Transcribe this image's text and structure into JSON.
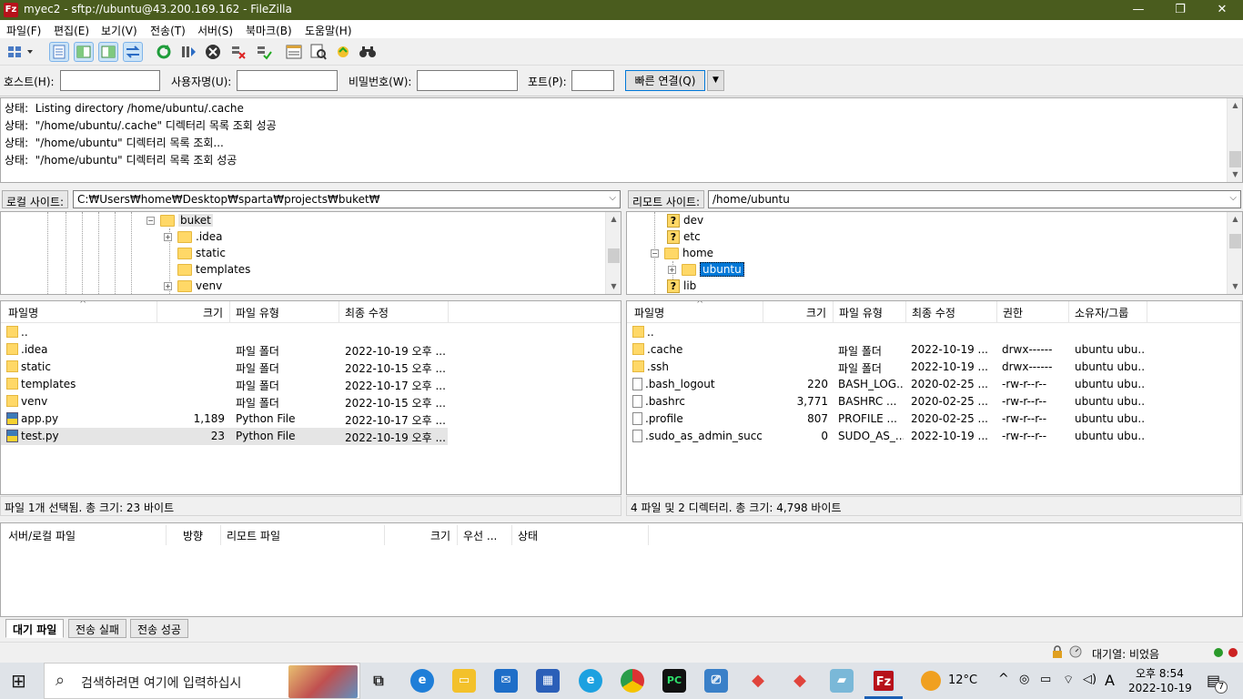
{
  "window": {
    "title": "myec2 - sftp://ubuntu@43.200.169.162 - FileZilla",
    "app_icon": "Fz",
    "controls": {
      "minimize": "—",
      "restore": "❐",
      "close": "✕"
    }
  },
  "menu": [
    "파일(F)",
    "편집(E)",
    "보기(V)",
    "전송(T)",
    "서버(S)",
    "북마크(B)",
    "도움말(H)"
  ],
  "quickconnect": {
    "host_label": "호스트(H):",
    "user_label": "사용자명(U):",
    "pass_label": "비밀번호(W):",
    "port_label": "포트(P):",
    "host_value": "",
    "user_value": "",
    "pass_value": "",
    "port_value": "",
    "connect_label": "빠른 연결(Q)",
    "dropdown": "▼"
  },
  "log": [
    {
      "tag": "상태:",
      "msg": "Listing directory /home/ubuntu/.cache"
    },
    {
      "tag": "상태:",
      "msg": "\"/home/ubuntu/.cache\" 디렉터리 목록 조회 성공"
    },
    {
      "tag": "상태:",
      "msg": "\"/home/ubuntu\" 디렉터리 목록 조회..."
    },
    {
      "tag": "상태:",
      "msg": "\"/home/ubuntu\" 디렉터리 목록 조회 성공"
    }
  ],
  "local": {
    "site_label": "로컬 사이트:",
    "path": "C:₩Users₩home₩Desktop₩sparta₩projects₩buket₩",
    "tree": {
      "root": "buket",
      "children": [
        ".idea",
        "static",
        "templates",
        "venv"
      ],
      "expand_open": "−",
      "expand_closed": "+"
    },
    "columns": {
      "name": "파일명",
      "size": "크기",
      "type": "파일 유형",
      "modified": "최종 수정"
    },
    "files": [
      {
        "name": "..",
        "size": "",
        "type": "",
        "modified": "",
        "kind": "folder"
      },
      {
        "name": ".idea",
        "size": "",
        "type": "파일 폴더",
        "modified": "2022-10-19 오후 ...",
        "kind": "folder"
      },
      {
        "name": "static",
        "size": "",
        "type": "파일 폴더",
        "modified": "2022-10-15 오후 ...",
        "kind": "folder"
      },
      {
        "name": "templates",
        "size": "",
        "type": "파일 폴더",
        "modified": "2022-10-17 오후 ...",
        "kind": "folder"
      },
      {
        "name": "venv",
        "size": "",
        "type": "파일 폴더",
        "modified": "2022-10-15 오후 ...",
        "kind": "folder"
      },
      {
        "name": "app.py",
        "size": "1,189",
        "type": "Python File",
        "modified": "2022-10-17 오후 ...",
        "kind": "py"
      },
      {
        "name": "test.py",
        "size": "23",
        "type": "Python File",
        "modified": "2022-10-19 오후 ...",
        "kind": "py",
        "selected": true
      }
    ],
    "status": "파일 1개 선택됨. 총 크기: 23 바이트"
  },
  "remote": {
    "site_label": "리모트 사이트:",
    "path": "/home/ubuntu",
    "tree": {
      "items": [
        "dev",
        "etc",
        "home",
        "ubuntu",
        "lib"
      ],
      "unknown_mark": "?",
      "expand_open": "−",
      "expand_closed": "+"
    },
    "columns": {
      "name": "파일명",
      "size": "크기",
      "type": "파일 유형",
      "modified": "최종 수정",
      "perm": "권한",
      "owner": "소유자/그룹"
    },
    "files": [
      {
        "name": "..",
        "size": "",
        "type": "",
        "modified": "",
        "perm": "",
        "owner": "",
        "kind": "folder"
      },
      {
        "name": ".cache",
        "size": "",
        "type": "파일 폴더",
        "modified": "2022-10-19 ...",
        "perm": "drwx------",
        "owner": "ubuntu ubu...",
        "kind": "folder"
      },
      {
        "name": ".ssh",
        "size": "",
        "type": "파일 폴더",
        "modified": "2022-10-19 ...",
        "perm": "drwx------",
        "owner": "ubuntu ubu...",
        "kind": "folder"
      },
      {
        "name": ".bash_logout",
        "size": "220",
        "type": "BASH_LOG...",
        "modified": "2020-02-25 ...",
        "perm": "-rw-r--r--",
        "owner": "ubuntu ubu...",
        "kind": "file"
      },
      {
        "name": ".bashrc",
        "size": "3,771",
        "type": "BASHRC ...",
        "modified": "2020-02-25 ...",
        "perm": "-rw-r--r--",
        "owner": "ubuntu ubu...",
        "kind": "file"
      },
      {
        "name": ".profile",
        "size": "807",
        "type": "PROFILE ...",
        "modified": "2020-02-25 ...",
        "perm": "-rw-r--r--",
        "owner": "ubuntu ubu...",
        "kind": "file"
      },
      {
        "name": ".sudo_as_admin_succ...",
        "size": "0",
        "type": "SUDO_AS_...",
        "modified": "2022-10-19 ...",
        "perm": "-rw-r--r--",
        "owner": "ubuntu ubu...",
        "kind": "file"
      }
    ],
    "status": "4 파일 및 2 디렉터리. 총 크기: 4,798 바이트"
  },
  "queue": {
    "columns": {
      "local": "서버/로컬 파일",
      "direction": "방향",
      "remote": "리모트 파일",
      "size": "크기",
      "priority": "우선 ...",
      "status": "상태"
    },
    "tabs": [
      "대기 파일",
      "전송 실패",
      "전송 성공"
    ]
  },
  "statusbar": {
    "queue_text": "대기열: 비었음"
  },
  "taskbar": {
    "search_placeholder": "검색하려면 여기에 입력하십시",
    "weather": "12°C",
    "ime": "A",
    "time": "오후 8:54",
    "date": "2022-10-19",
    "notification_count": "7"
  },
  "icons": {
    "search": "⌕",
    "windows": "⊞",
    "sort_arrow": "^",
    "scroll_up": "▲",
    "scroll_down": "▼",
    "combo_arrow": "⌵"
  }
}
